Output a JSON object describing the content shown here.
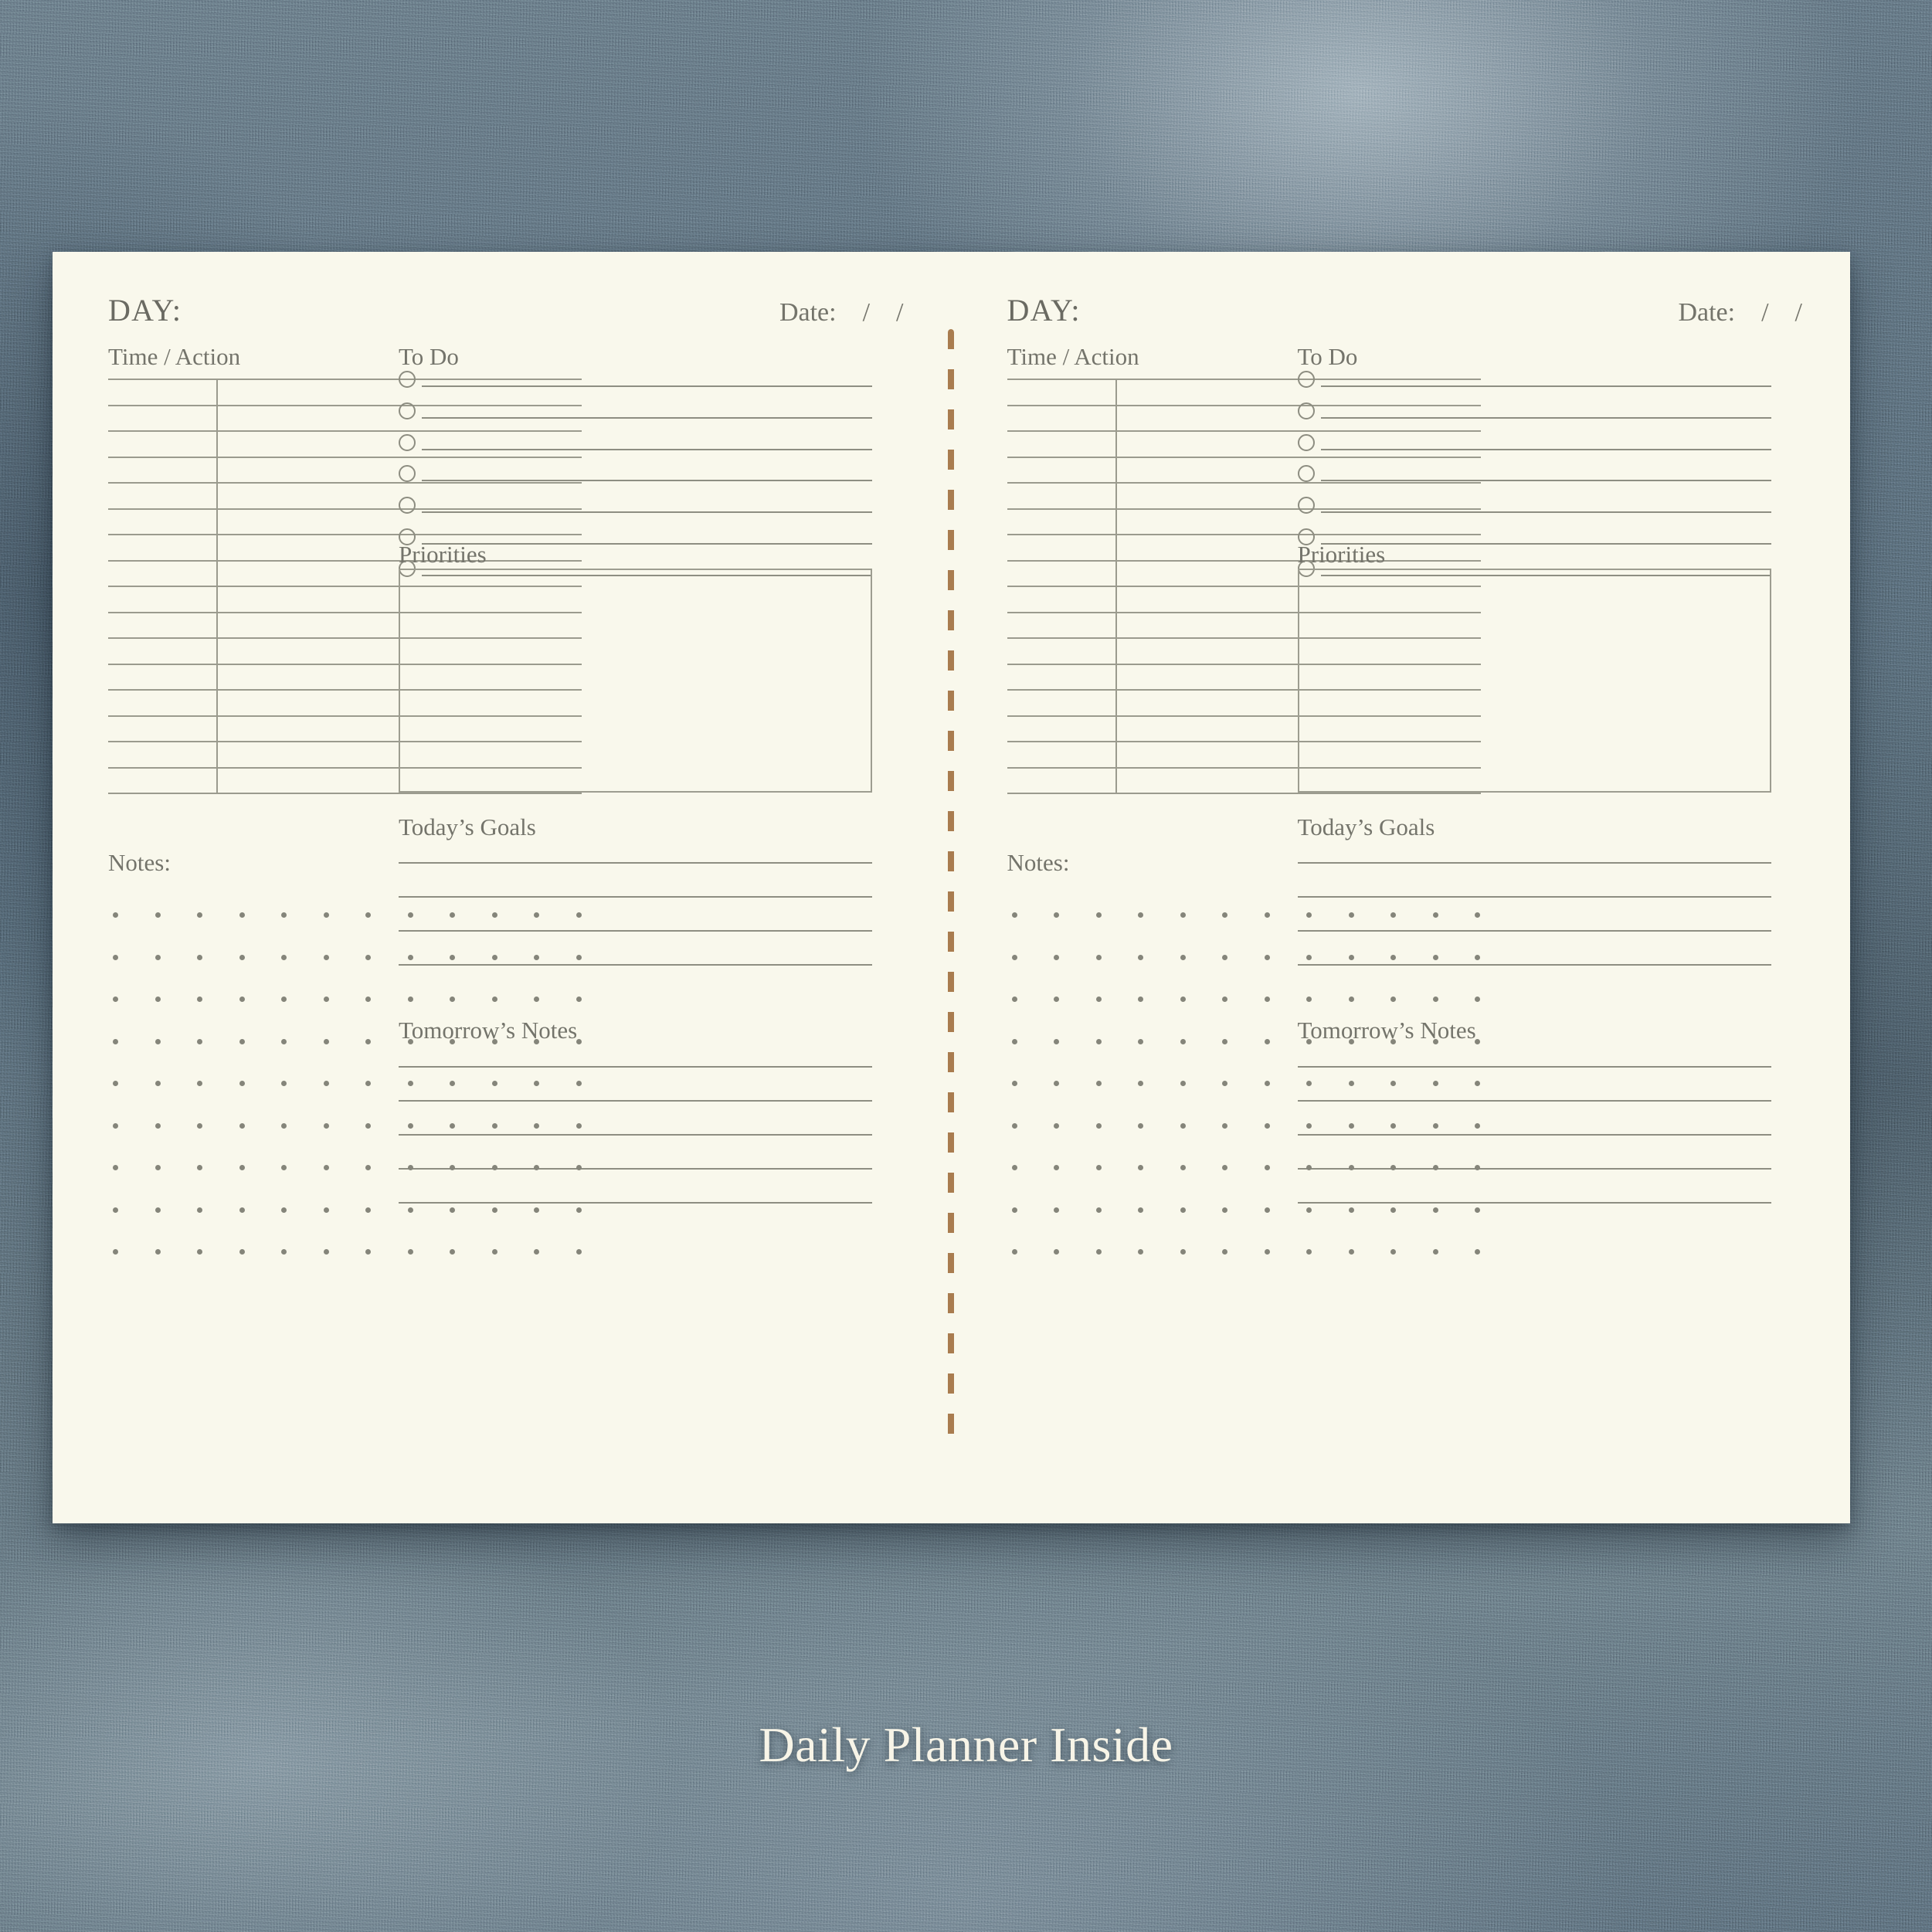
{
  "caption": "Daily Planner Inside",
  "colors": {
    "paper": "#f9f8ec",
    "ink": "#74746b",
    "rule": "#9b9b8e",
    "binding": "#a97c4f",
    "dot": "#85857a",
    "backdrop": "#62747f",
    "caption_text": "#f7f4e7"
  },
  "spread": {
    "pages": [
      {
        "id": "left-page",
        "day_label": "DAY:",
        "date_label": "Date:    /    /",
        "time_action": {
          "heading": "Time / Action",
          "rows": 16
        },
        "todo": {
          "heading": "To Do",
          "items": 7
        },
        "priorities": {
          "heading": "Priorities"
        },
        "todays_goals": {
          "heading": "Today’s Goals",
          "lines": 4
        },
        "tomorrows_notes": {
          "heading": "Tomorrow’s Notes",
          "lines": 5
        },
        "notes": {
          "heading": "Notes:",
          "dot_columns": 12,
          "dot_rows": 9
        }
      },
      {
        "id": "right-page",
        "day_label": "DAY:",
        "date_label": "Date:    /    /",
        "time_action": {
          "heading": "Time / Action",
          "rows": 16
        },
        "todo": {
          "heading": "To Do",
          "items": 7
        },
        "priorities": {
          "heading": "Priorities"
        },
        "todays_goals": {
          "heading": "Today’s Goals",
          "lines": 4
        },
        "tomorrows_notes": {
          "heading": "Tomorrow’s Notes",
          "lines": 5
        },
        "notes": {
          "heading": "Notes:",
          "dot_columns": 12,
          "dot_rows": 9
        }
      }
    ]
  }
}
